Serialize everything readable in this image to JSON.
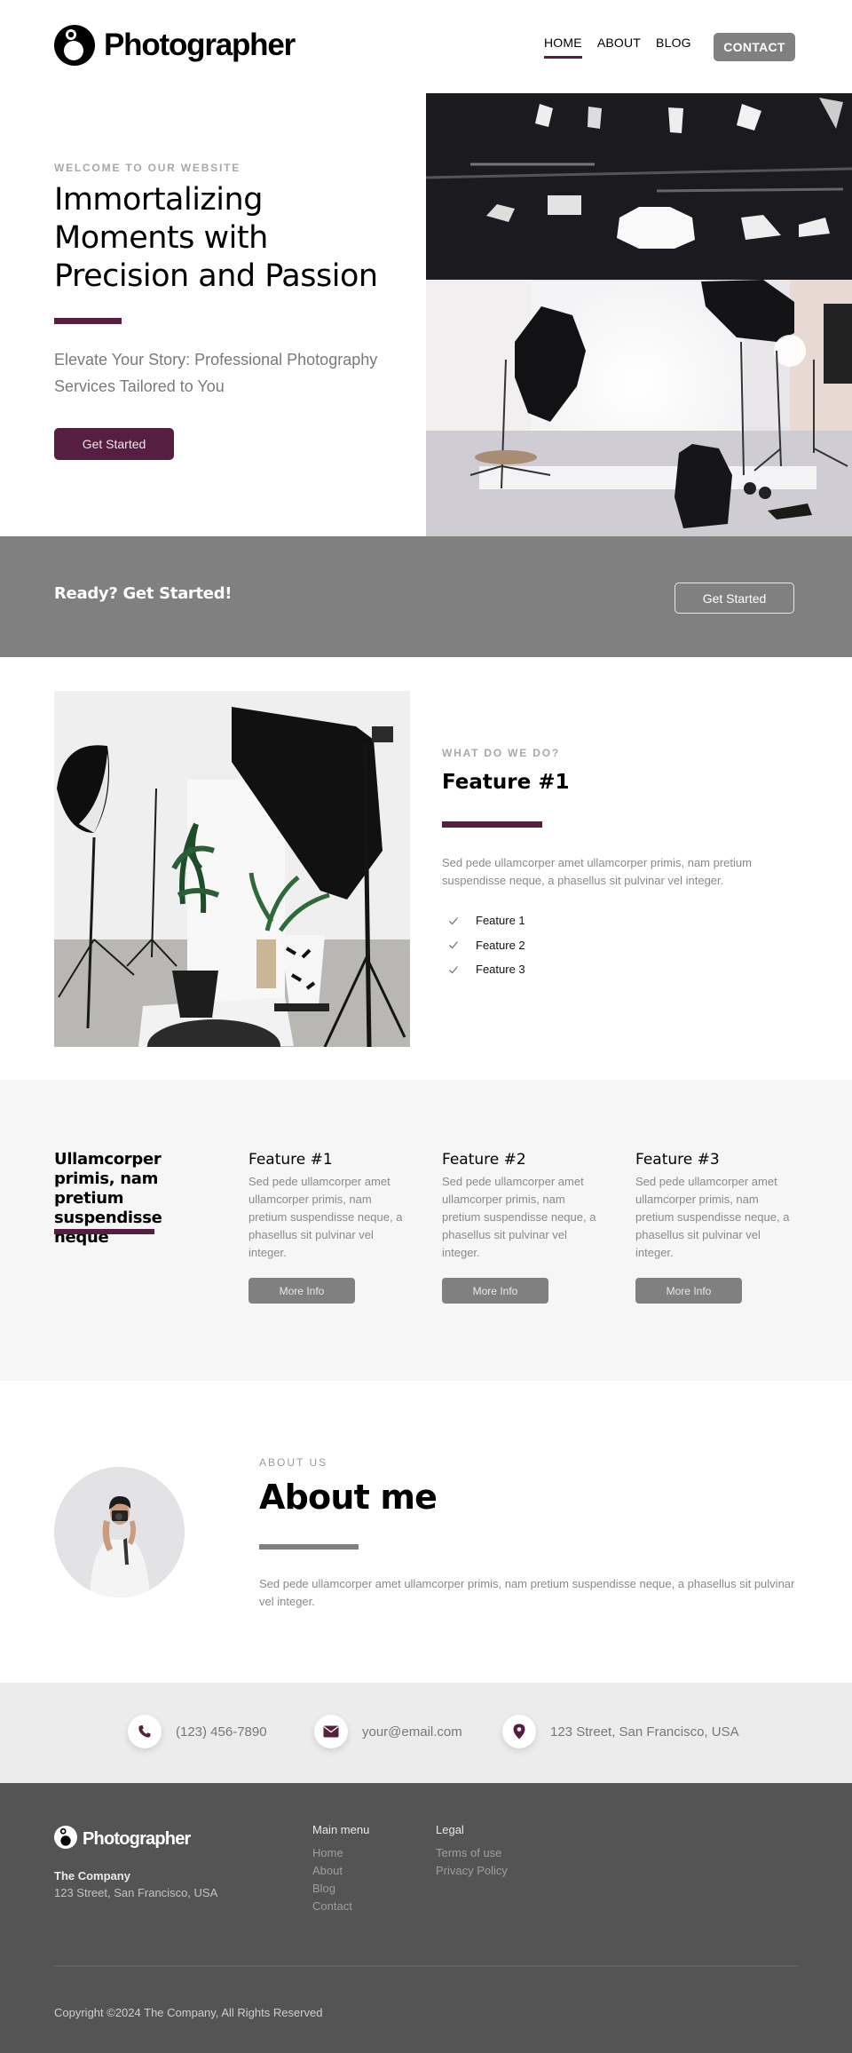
{
  "header": {
    "brand": "Photographer",
    "nav": [
      {
        "label": "HOME",
        "active": true
      },
      {
        "label": "ABOUT",
        "active": false
      },
      {
        "label": "BLOG",
        "active": false
      }
    ],
    "contact_button": "CONTACT"
  },
  "hero": {
    "eyebrow": "WELCOME TO OUR WEBSITE",
    "title": "Immortalizing Moments with Precision and Passion",
    "subtitle": "Elevate Your Story: Professional Photography Services Tailored to You",
    "cta_label": "Get Started",
    "image_alt": "Photography studio with softboxes and lights"
  },
  "cta_band": {
    "text": "Ready? Get Started!",
    "button_label": "Get Started"
  },
  "feature": {
    "eyebrow": "WHAT DO WE DO?",
    "title": "Feature #1",
    "description": "Sed pede ullamcorper amet ullamcorper primis, nam pretium suspendisse neque, a phasellus sit pulvinar vel integer.",
    "items": [
      "Feature 1",
      "Feature 2",
      "Feature 3"
    ],
    "image_alt": "Studio with plants and softbox"
  },
  "features_grid": {
    "heading": "Ullamcorper primis, nam pretium suspendisse neque",
    "columns": [
      {
        "title": "Feature #1",
        "text": "Sed pede ullamcorper amet ullamcorper primis, nam pretium suspendisse neque, a phasellus sit pulvinar vel integer.",
        "button": "More Info"
      },
      {
        "title": "Feature #2",
        "text": "Sed pede ullamcorper amet ullamcorper primis, nam pretium suspendisse neque, a phasellus sit pulvinar vel integer.",
        "button": "More Info"
      },
      {
        "title": "Feature #3",
        "text": "Sed pede ullamcorper amet ullamcorper primis, nam pretium suspendisse neque, a phasellus sit pulvinar vel integer.",
        "button": "More Info"
      }
    ]
  },
  "about": {
    "eyebrow": "ABOUT US",
    "title": "About me",
    "text": "Sed pede ullamcorper amet ullamcorper primis, nam pretium suspendisse neque, a phasellus sit pulvinar vel integer."
  },
  "contact": {
    "phone": "(123) 456-7890",
    "email": "your@email.com",
    "address": "123 Street, San Francisco, USA"
  },
  "footer": {
    "brand": "Photographer",
    "company": "The Company",
    "address": "123 Street, San Francisco, USA",
    "main_menu_title": "Main menu",
    "main_menu": [
      "Home",
      "About",
      "Blog",
      "Contact"
    ],
    "legal_title": "Legal",
    "legal": [
      "Terms of use",
      "Privacy Policy"
    ],
    "copyright": "Copyright ©2024 The Company, All Rights Reserved"
  },
  "colors": {
    "accent": "#561f41",
    "grey_button": "#808080",
    "footer_bg": "#545454"
  }
}
